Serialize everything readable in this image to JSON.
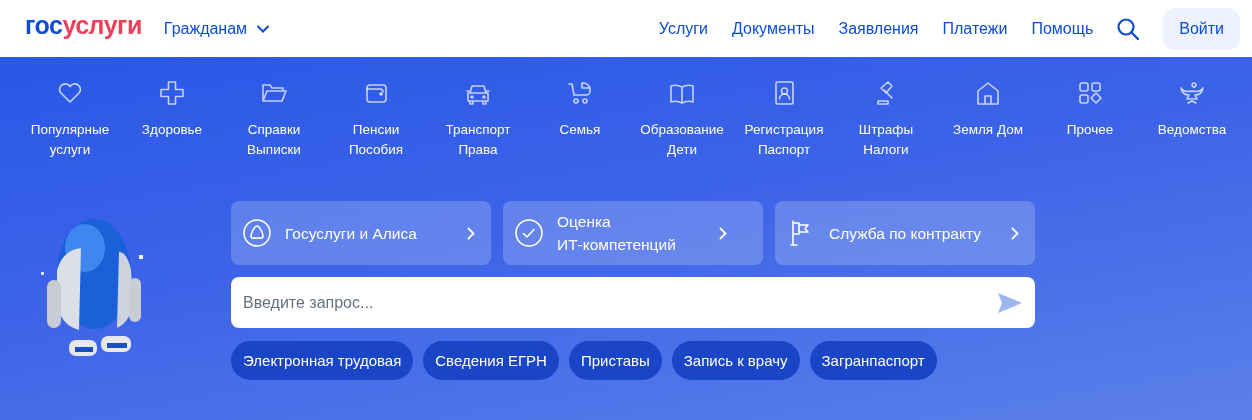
{
  "header": {
    "logo": {
      "first": "гос",
      "second": "услуги"
    },
    "audience": "Гражданам",
    "links": [
      "Услуги",
      "Документы",
      "Заявления",
      "Платежи",
      "Помощь"
    ],
    "login": "Войти"
  },
  "categories": [
    {
      "label": "Популярные услуги"
    },
    {
      "label": "Здоровье"
    },
    {
      "label": "Справки Выписки"
    },
    {
      "label": "Пенсии Пособия"
    },
    {
      "label": "Транспорт Права"
    },
    {
      "label": "Семья"
    },
    {
      "label": "Образование Дети"
    },
    {
      "label": "Регистрация Паспорт"
    },
    {
      "label": "Штрафы Налоги"
    },
    {
      "label": "Земля Дом"
    },
    {
      "label": "Прочее"
    },
    {
      "label": "Ведомства"
    }
  ],
  "promo_cards": [
    {
      "label": "Госуслуги и Алиса"
    },
    {
      "label": "Оценка ИТ-компетенций"
    },
    {
      "label": "Служба по контракту"
    }
  ],
  "search": {
    "placeholder": "Введите запрос..."
  },
  "quick_links": [
    "Электронная трудовая",
    "Сведения ЕГРН",
    "Приставы",
    "Запись к врачу",
    "Загранпаспорт"
  ]
}
